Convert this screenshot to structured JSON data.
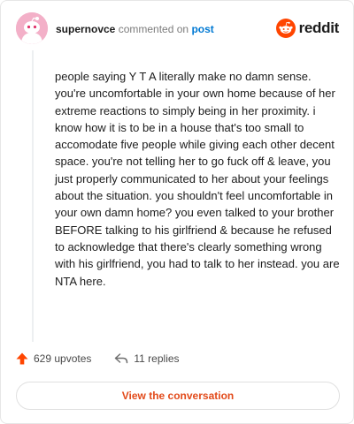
{
  "header": {
    "username": "supernovce",
    "commented_on": "commented on",
    "post_link": "post"
  },
  "brand": {
    "logo": "reddit-logo",
    "wordmark": "reddit",
    "accent_color": "#ff4500"
  },
  "comment": {
    "body": "people saying Y T A literally make no damn sense. you're uncomfortable in your own home because of her extreme reactions to simply being in her proximity. i know how it is to be in a house that's too small to accomodate five people while giving each other decent space. you're not telling her to go fuck off & leave, you just properly communicated to her about your feelings about the situation. you shouldn't feel uncomfortable in your own damn home? you even talked to your brother BEFORE talking to his girlfriend & because he refused to acknowledge that there's clearly something wrong with his girlfriend, you had to talk to her instead. you are NTA here."
  },
  "actions": {
    "upvotes": "629 upvotes",
    "upvote_icon": "upvote-arrow-icon",
    "replies": "11 replies",
    "reply_icon": "reply-arrow-icon"
  },
  "cta": {
    "label": "View the conversation"
  },
  "colors": {
    "link": "#0079d3",
    "upvote": "#ff4500",
    "cta_text": "#e24a1a",
    "avatar_bg": "#f3b0c8"
  }
}
